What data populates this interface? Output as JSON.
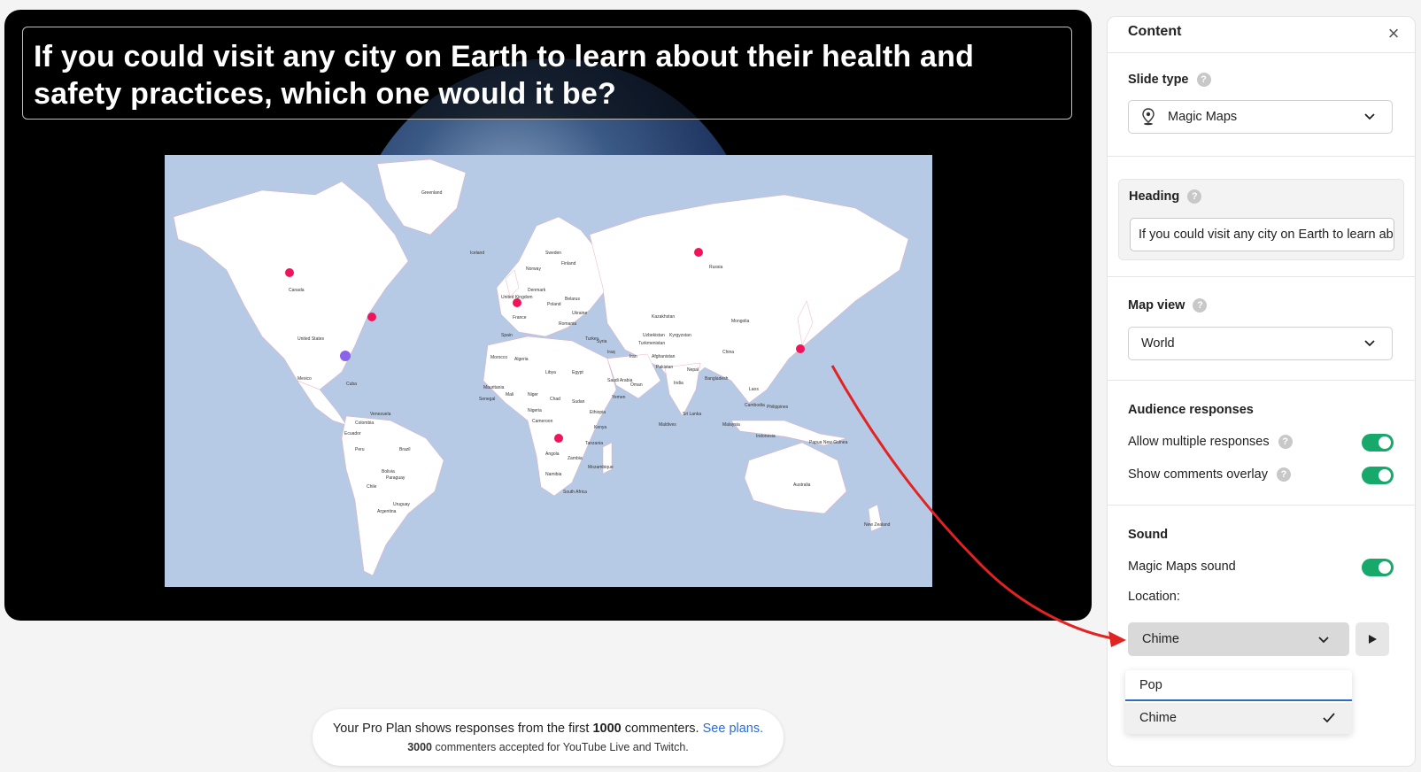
{
  "slide": {
    "heading": "If you could visit any city on Earth to learn about their health and safety practices, which one would it be?",
    "map_labels": [
      "Greenland",
      "Canada",
      "United States",
      "Mexico",
      "Cuba",
      "Colombia",
      "Peru",
      "Brazil",
      "Bolivia",
      "Paraguay",
      "Argentina",
      "Chile",
      "Uruguay",
      "Venezuela",
      "Ecuador",
      "Iceland",
      "Sweden",
      "Finland",
      "Norway",
      "Denmark",
      "Poland",
      "Ukraine",
      "Belarus",
      "United Kingdom",
      "France",
      "Spain",
      "Romania",
      "Turkey",
      "Morocco",
      "Algeria",
      "Libya",
      "Egypt",
      "Mali",
      "Niger",
      "Chad",
      "Sudan",
      "Nigeria",
      "Ethiopia",
      "Senegal",
      "Mauritania",
      "Cameroon",
      "Kenya",
      "Angola",
      "Zambia",
      "Namibia",
      "Tanzania",
      "Mozambique",
      "South Africa",
      "Saudi Arabia",
      "Yemen",
      "Oman",
      "Iraq",
      "Iran",
      "Syria",
      "Russia",
      "Kazakhstan",
      "Uzbekistan",
      "Turkmenistan",
      "Kyrgyzstan",
      "Afghanistan",
      "Pakistan",
      "India",
      "Nepal",
      "Bangladesh",
      "Sri Lanka",
      "Maldives",
      "China",
      "Mongolia",
      "Laos",
      "Cambodia",
      "Malaysia",
      "Philippines",
      "Indonesia",
      "Papua New Guinea",
      "Australia",
      "New Zealand"
    ]
  },
  "banner": {
    "line1_prefix": "Your Pro Plan shows responses from the first ",
    "line1_count": "1000",
    "line1_suffix": " commenters. ",
    "line1_link": "See plans.",
    "line2_count": "3000",
    "line2_suffix": " commenters accepted for YouTube Live and Twitch."
  },
  "panel": {
    "title": "Content",
    "slide_type": {
      "label": "Slide type",
      "value": "Magic Maps"
    },
    "heading": {
      "label": "Heading",
      "value": "If you could visit any city on Earth to learn about their health and safety practices, which one would it be?"
    },
    "map_view": {
      "label": "Map view",
      "value": "World"
    },
    "audience": {
      "label": "Audience responses",
      "allow_multiple": "Allow multiple responses",
      "show_comments": "Show comments overlay"
    },
    "sound": {
      "label": "Sound",
      "magic_maps_sound": "Magic Maps sound",
      "location_label": "Location:",
      "selected": "Chime",
      "options": [
        "Pop",
        "Chime"
      ]
    }
  },
  "colors": {
    "toggle_on": "#17a86b",
    "pin_pink": "#f0145a",
    "pin_purple": "#8a63e8",
    "arrow": "#e32222",
    "map_water": "#b6cae6",
    "link": "#2d6bd8"
  },
  "icons": [
    "help-icon",
    "location-pin-icon",
    "chevron-down-icon",
    "close-icon",
    "play-icon",
    "check-icon"
  ]
}
